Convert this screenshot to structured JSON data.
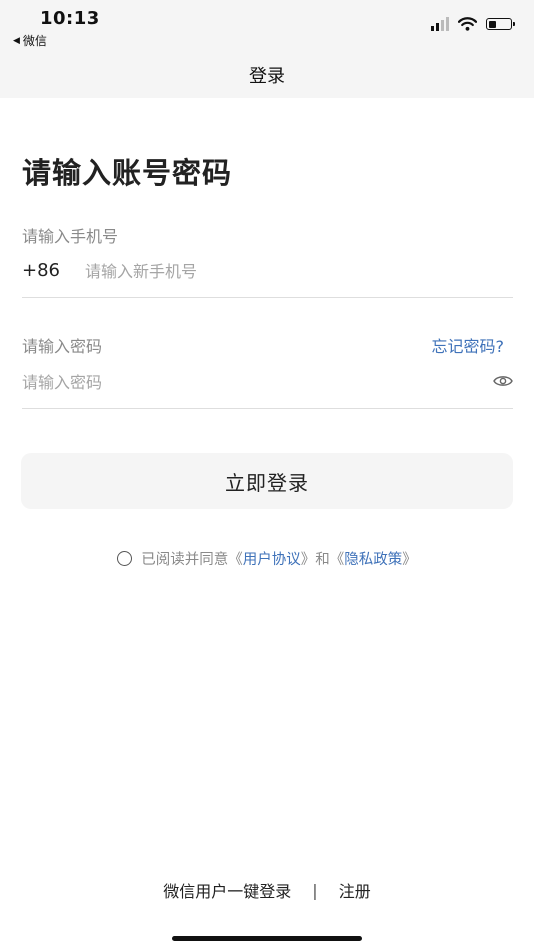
{
  "status_bar": {
    "time": "10:13",
    "back_app": "微信",
    "back_arrow": "◀",
    "signal_icon": "cellular-signal-icon",
    "wifi_icon": "wifi-icon",
    "battery_icon": "battery-icon",
    "battery_level": 0.45
  },
  "nav": {
    "title": "登录"
  },
  "form": {
    "heading": "请输入账号密码",
    "phone": {
      "label": "请输入手机号",
      "prefix": "+86",
      "placeholder": "请输入新手机号",
      "value": ""
    },
    "password": {
      "label": "请输入密码",
      "placeholder": "请输入密码",
      "value": "",
      "forgot_label": "忘记密码?",
      "visibility_icon": "eye-icon"
    },
    "submit_label": "立即登录"
  },
  "agreement": {
    "checked": false,
    "prefix": "已阅读并同意《",
    "terms_link": "用户协议",
    "middle": "》和《",
    "privacy_link": "隐私政策",
    "suffix": "》"
  },
  "footer": {
    "wechat_login_label": "微信用户一键登录",
    "separator": "|",
    "register_label": "注册"
  },
  "colors": {
    "link": "#3f72b9",
    "placeholder": "#a5a5a5",
    "label": "#8a8a8a",
    "top_background": "#f5f5f5",
    "button_background": "#f5f5f5"
  }
}
